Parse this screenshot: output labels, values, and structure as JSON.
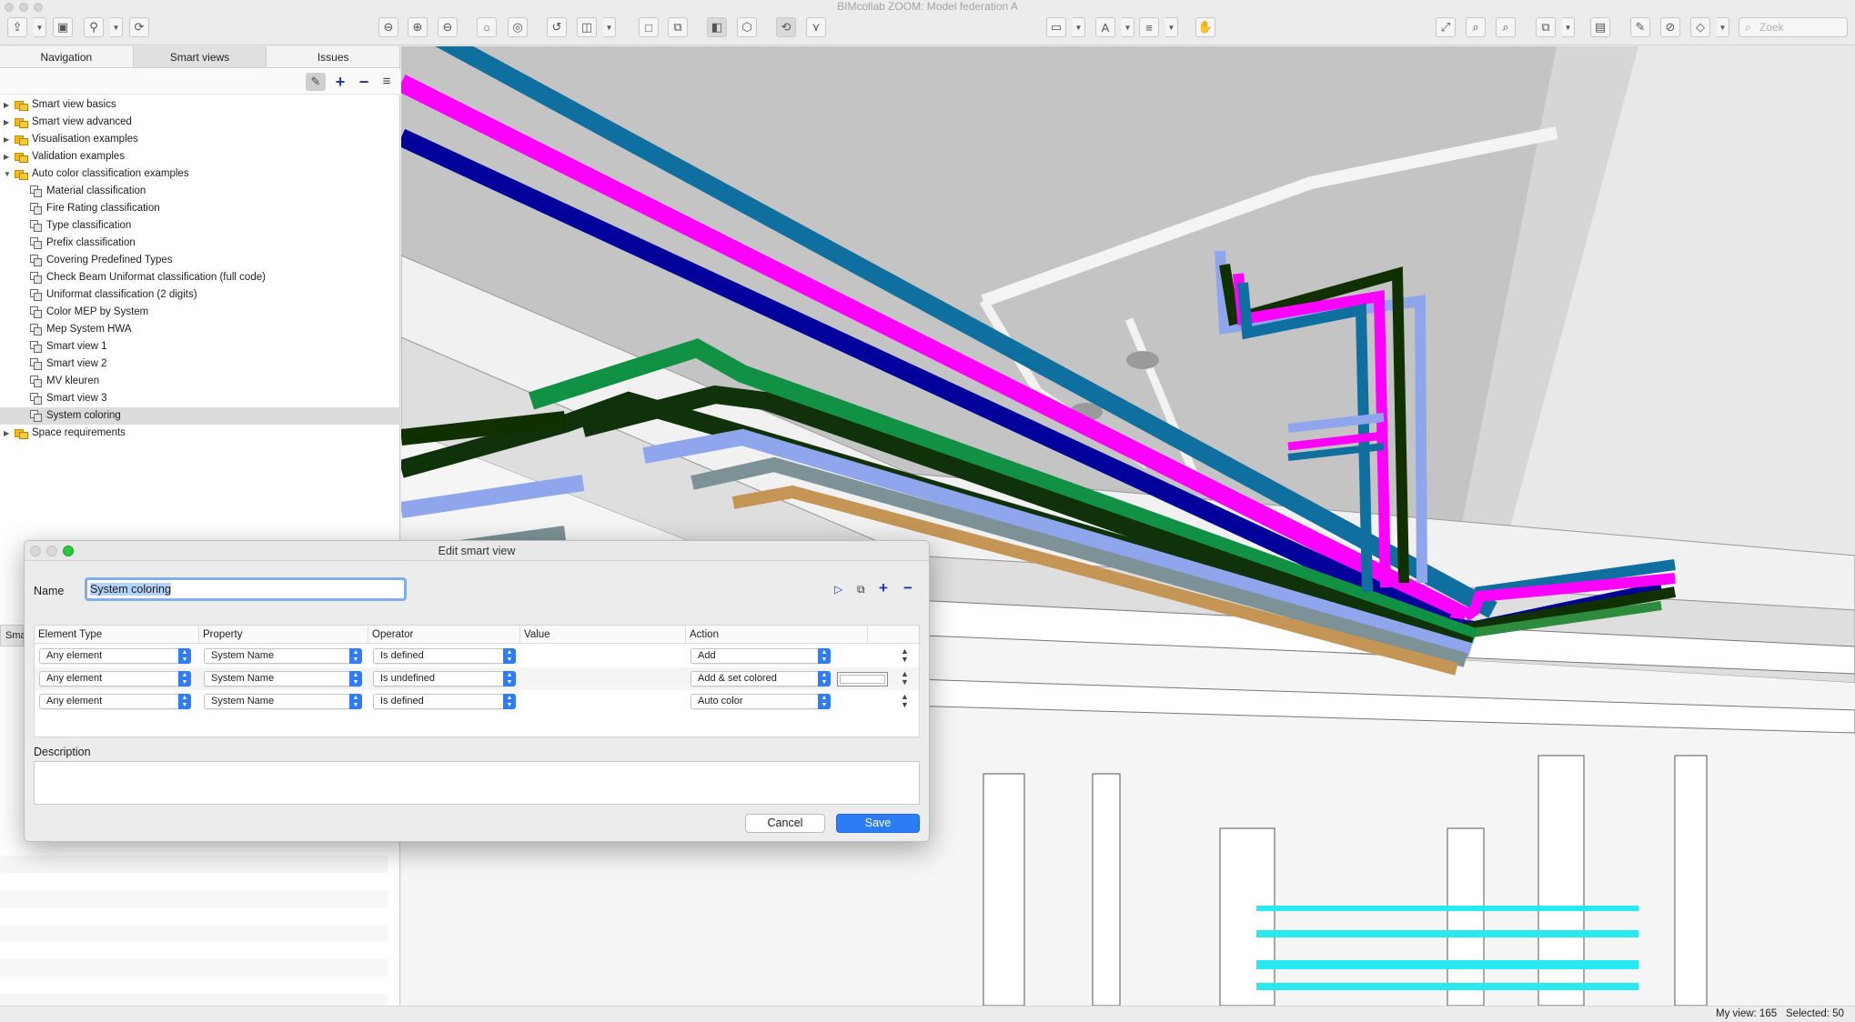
{
  "window": {
    "title": "BIMcollab ZOOM: Model federation A"
  },
  "toolbar": {
    "search_placeholder": "Zoek"
  },
  "tabs": [
    "Navigation",
    "Smart views",
    "Issues"
  ],
  "tree": [
    {
      "label": "Smart view basics",
      "type": "folder",
      "expanded": false,
      "level": 0
    },
    {
      "label": "Smart view advanced",
      "type": "folder",
      "expanded": false,
      "level": 0
    },
    {
      "label": "Visualisation examples",
      "type": "folder",
      "expanded": false,
      "level": 0
    },
    {
      "label": "Validation examples",
      "type": "folder",
      "expanded": false,
      "level": 0
    },
    {
      "label": "Auto color classification examples",
      "type": "folder",
      "expanded": true,
      "level": 0
    },
    {
      "label": "Material classification",
      "type": "view",
      "level": 1
    },
    {
      "label": "Fire Rating classification",
      "type": "view",
      "level": 1
    },
    {
      "label": "Type classification",
      "type": "view",
      "level": 1
    },
    {
      "label": "Prefix classification",
      "type": "view",
      "level": 1
    },
    {
      "label": "Covering Predefined Types",
      "type": "view",
      "level": 1
    },
    {
      "label": "Check Beam Uniformat classification (full code)",
      "type": "view",
      "level": 1
    },
    {
      "label": "Uniformat classification (2 digits)",
      "type": "view",
      "level": 1
    },
    {
      "label": "Color MEP by System",
      "type": "view",
      "level": 1
    },
    {
      "label": "Mep System HWA",
      "type": "view",
      "level": 1
    },
    {
      "label": "Smart view 1",
      "type": "view",
      "level": 1
    },
    {
      "label": "Smart view 2",
      "type": "view",
      "level": 1
    },
    {
      "label": "MV kleuren",
      "type": "view",
      "level": 1
    },
    {
      "label": "Smart view 3",
      "type": "view",
      "level": 1
    },
    {
      "label": "System coloring",
      "type": "view",
      "level": 1,
      "selected": true
    },
    {
      "label": "Space requirements",
      "type": "folder",
      "expanded": false,
      "level": 0
    }
  ],
  "side_cut_label": "Sma",
  "dialog": {
    "title": "Edit smart view",
    "name_label": "Name",
    "name_value": "System coloring",
    "columns": [
      "Element Type",
      "Property",
      "Operator",
      "Value",
      "Action"
    ],
    "rules": [
      {
        "element_type": "Any element",
        "property": "System Name",
        "operator": "Is defined",
        "value": "",
        "action": "Add",
        "color_well": false
      },
      {
        "element_type": "Any element",
        "property": "System Name",
        "operator": "Is undefined",
        "value": "",
        "action": "Add & set colored",
        "color_well": true
      },
      {
        "element_type": "Any element",
        "property": "System Name",
        "operator": "Is defined",
        "value": "",
        "action": "Auto color",
        "color_well": false
      }
    ],
    "description_label": "Description",
    "description_value": "",
    "cancel_label": "Cancel",
    "save_label": "Save"
  },
  "status": {
    "my_view": "My view: 165",
    "selected": "Selected: 50"
  },
  "colors": {
    "accent": "#2b7cf5",
    "folder": "#f2b81a",
    "tool_blue": "#2234b8"
  }
}
